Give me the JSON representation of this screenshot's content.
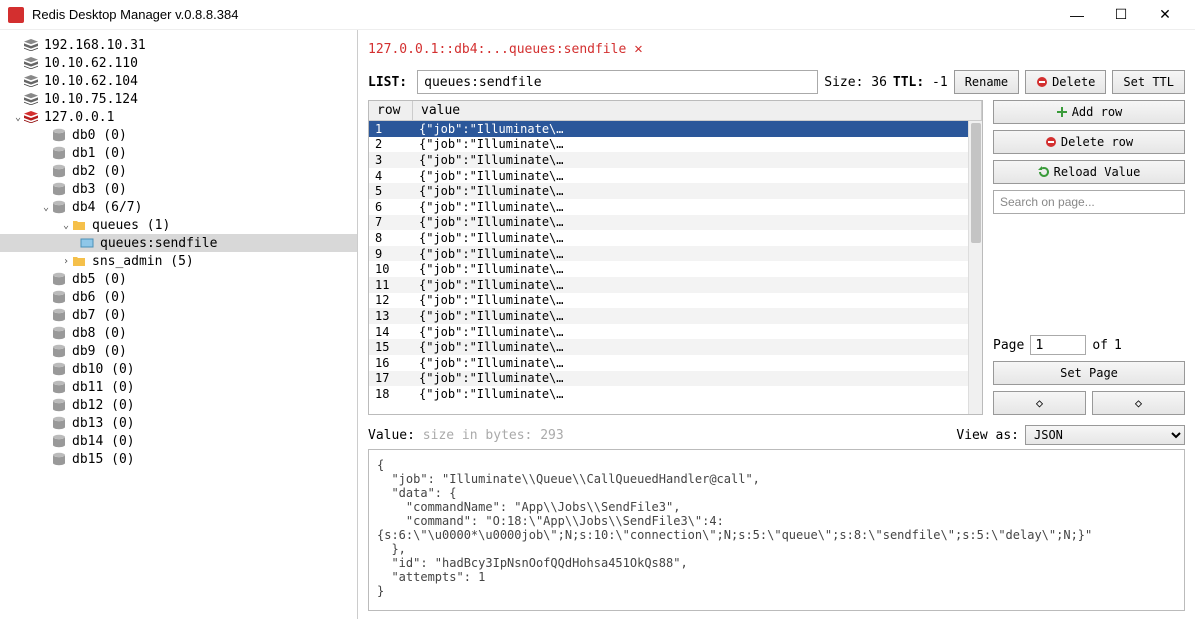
{
  "window": {
    "title": "Redis Desktop Manager v.0.8.8.384"
  },
  "sidebar": {
    "servers": [
      {
        "label": "192.168.10.31"
      },
      {
        "label": "10.10.62.110"
      },
      {
        "label": "10.10.62.104"
      },
      {
        "label": "10.10.75.124"
      }
    ],
    "activeServer": "127.0.0.1",
    "dbsTop": [
      "db0 (0)",
      "db1 (0)",
      "db2 (0)",
      "db3 (0)"
    ],
    "db4": "db4  (6/7)",
    "queuesFolder": "queues (1)",
    "queuesKey": "queues:sendfile",
    "snsFolder": "sns_admin (5)",
    "dbsBottom": [
      "db5 (0)",
      "db6 (0)",
      "db7 (0)",
      "db8 (0)",
      "db9 (0)",
      "db10 (0)",
      "db11 (0)",
      "db12 (0)",
      "db13 (0)",
      "db14 (0)",
      "db15 (0)"
    ]
  },
  "tab": {
    "label": "127.0.0.1::db4:...queues:sendfile"
  },
  "key": {
    "typeLabel": "LIST:",
    "name": "queues:sendfile",
    "sizeLabel": "Size:",
    "size": "36",
    "ttlLabel": "TTL:",
    "ttl": "-1"
  },
  "buttons": {
    "rename": "Rename",
    "delete": "Delete",
    "setTtl": "Set TTL",
    "addRow": "Add row",
    "deleteRow": "Delete row",
    "reload": "Reload Value",
    "setPage": "Set Page"
  },
  "table": {
    "headers": {
      "row": "row",
      "value": "value"
    },
    "rows": [
      {
        "n": "1",
        "v": "{\"job\":\"Illuminate\\…"
      },
      {
        "n": "2",
        "v": "{\"job\":\"Illuminate\\…"
      },
      {
        "n": "3",
        "v": "{\"job\":\"Illuminate\\…"
      },
      {
        "n": "4",
        "v": "{\"job\":\"Illuminate\\…"
      },
      {
        "n": "5",
        "v": "{\"job\":\"Illuminate\\…"
      },
      {
        "n": "6",
        "v": "{\"job\":\"Illuminate\\…"
      },
      {
        "n": "7",
        "v": "{\"job\":\"Illuminate\\…"
      },
      {
        "n": "8",
        "v": "{\"job\":\"Illuminate\\…"
      },
      {
        "n": "9",
        "v": "{\"job\":\"Illuminate\\…"
      },
      {
        "n": "10",
        "v": "{\"job\":\"Illuminate\\…"
      },
      {
        "n": "11",
        "v": "{\"job\":\"Illuminate\\…"
      },
      {
        "n": "12",
        "v": "{\"job\":\"Illuminate\\…"
      },
      {
        "n": "13",
        "v": "{\"job\":\"Illuminate\\…"
      },
      {
        "n": "14",
        "v": "{\"job\":\"Illuminate\\…"
      },
      {
        "n": "15",
        "v": "{\"job\":\"Illuminate\\…"
      },
      {
        "n": "16",
        "v": "{\"job\":\"Illuminate\\…"
      },
      {
        "n": "17",
        "v": "{\"job\":\"Illuminate\\…"
      },
      {
        "n": "18",
        "v": "{\"job\":\"Illuminate\\…"
      }
    ]
  },
  "search": {
    "placeholder": "Search on page..."
  },
  "pager": {
    "pageLabel": "Page",
    "page": "1",
    "ofLabel": "of",
    "total": "1"
  },
  "valuePanel": {
    "label": "Value:",
    "sizeText": "size in bytes: 293",
    "viewAsLabel": "View as:",
    "viewAs": "JSON",
    "body": "{\n  \"job\": \"Illuminate\\\\Queue\\\\CallQueuedHandler@call\",\n  \"data\": {\n    \"commandName\": \"App\\\\Jobs\\\\SendFile3\",\n    \"command\": \"O:18:\\\"App\\\\Jobs\\\\SendFile3\\\":4:{s:6:\\\"\\u0000*\\u0000job\\\";N;s:10:\\\"connection\\\";N;s:5:\\\"queue\\\";s:8:\\\"sendfile\\\";s:5:\\\"delay\\\";N;}\"\n  },\n  \"id\": \"hadBcy3IpNsnOofQQdHohsa451OkQs88\",\n  \"attempts\": 1\n}"
  }
}
